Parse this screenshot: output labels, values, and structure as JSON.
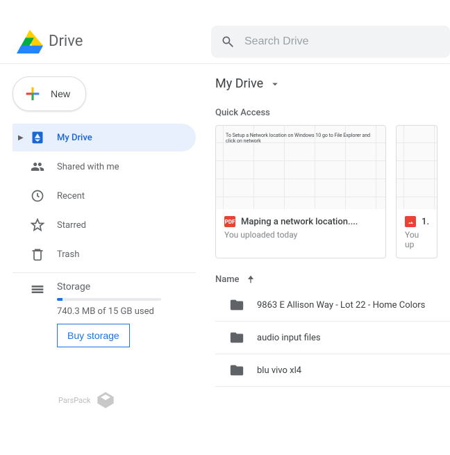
{
  "app": {
    "name": "Drive"
  },
  "search": {
    "placeholder": "Search Drive"
  },
  "newButton": {
    "label": "New"
  },
  "sidebar": {
    "items": [
      {
        "label": "My Drive"
      },
      {
        "label": "Shared with me"
      },
      {
        "label": "Recent"
      },
      {
        "label": "Starred"
      },
      {
        "label": "Trash"
      }
    ],
    "storage": {
      "label": "Storage",
      "used_text": "740.3 MB of 15 GB used",
      "buy_label": "Buy storage",
      "percent_used": 5
    }
  },
  "breadcrumb": {
    "current": "My Drive"
  },
  "quick_access": {
    "title": "Quick Access",
    "cards": [
      {
        "thumb_text": "To Setup a Network location on Windows 10 go to File Explorer and click on network",
        "badge": "PDF",
        "title": "Maping a network location....",
        "subtitle": "You uploaded today"
      },
      {
        "thumb_text": "",
        "badge": "IMG",
        "title": "1.",
        "subtitle": "You up"
      }
    ]
  },
  "list": {
    "header": "Name",
    "sort_dir": "asc",
    "rows": [
      {
        "name": "9863 E Allison Way - Lot 22 - Home Colors"
      },
      {
        "name": "audio input files"
      },
      {
        "name": "blu vivo xl4"
      }
    ]
  },
  "watermark": {
    "text": "ParsPack"
  }
}
